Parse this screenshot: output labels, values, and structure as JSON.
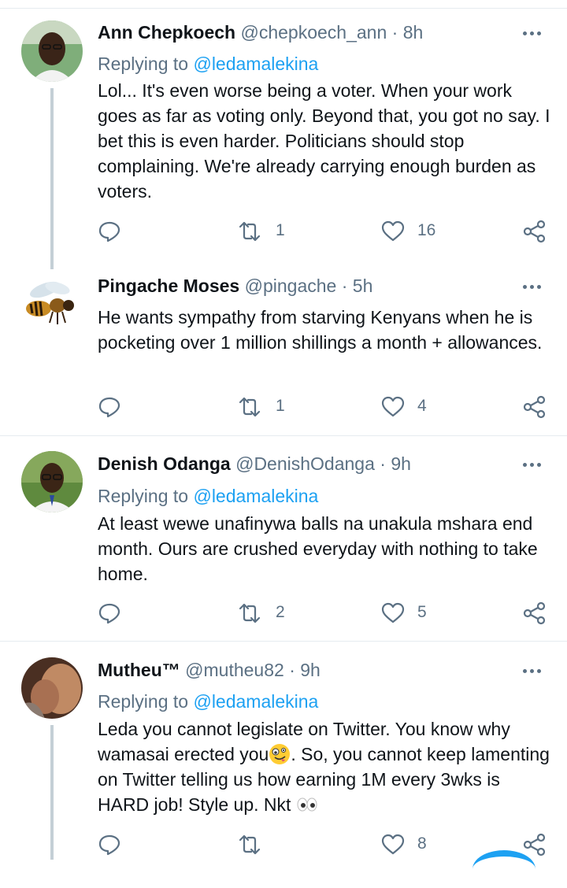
{
  "tweets": [
    {
      "name": "Ann Chepkoech",
      "handle": "@chepkoech_ann",
      "time": "8h",
      "replying_prefix": "Replying to ",
      "replying_to": "@ledamalekina",
      "text": "Lol... It's even worse being a voter. When your work goes as far as voting only. Beyond that, you got no say. I bet this is even harder. Politicians should stop complaining. We're already carrying enough burden as voters.",
      "retweets": "1",
      "likes": "16"
    },
    {
      "name": "Pingache Moses",
      "handle": "@pingache",
      "time": "5h",
      "text": "He wants sympathy from starving Kenyans when he is pocketing over 1 million shillings a month + allowances.",
      "retweets": "1",
      "likes": "4"
    },
    {
      "name": "Denish Odanga",
      "handle": "@DenishOdanga",
      "time": "9h",
      "replying_prefix": "Replying to ",
      "replying_to": "@ledamalekina",
      "text": "At least wewe unafinywa balls na unakula mshara end month. Ours are crushed everyday with nothing to take home.",
      "retweets": "2",
      "likes": "5"
    },
    {
      "name": "Mutheu™",
      "handle": "@mutheu82",
      "time": "9h",
      "replying_prefix": "Replying to ",
      "replying_to": "@ledamalekina",
      "text_a": "Leda you cannot legislate on Twitter. You know why wamasai erected you",
      "text_b": ". So, you cannot keep lamenting on Twitter telling us how earning 1M every 3wks is HARD job! Style up. Nkt ",
      "retweets": "",
      "likes": "8"
    }
  ],
  "separator": " · ",
  "icons": {
    "reply": "reply-icon",
    "retweet": "retweet-icon",
    "like": "like-icon",
    "share": "share-icon",
    "more": "more-icon"
  },
  "colors": {
    "name": "#0f1419",
    "secondary": "#5b7083",
    "link": "#1da1f2",
    "divider": "#e6ecf0",
    "thread_line": "#c4cfd6"
  }
}
